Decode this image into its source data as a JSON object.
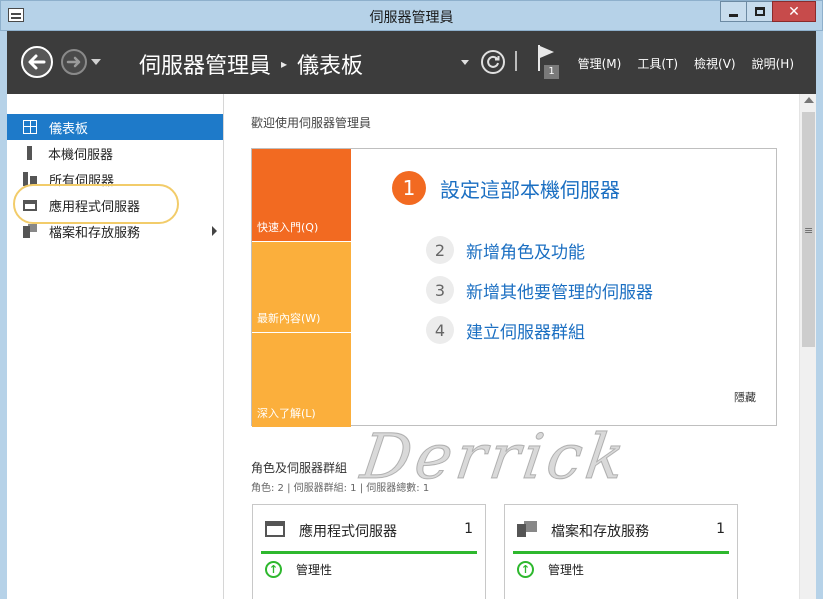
{
  "window": {
    "title": "伺服器管理員",
    "controls": {
      "minimize": "minimize",
      "maximize": "maximize",
      "close": "✕"
    }
  },
  "header": {
    "breadcrumb_root": "伺服器管理員",
    "breadcrumb_sep": "▸",
    "breadcrumb_current": "儀表板",
    "notification_count": "1",
    "menus": [
      "管理(M)",
      "工具(T)",
      "檢視(V)",
      "說明(H)"
    ]
  },
  "sidebar": {
    "items": [
      {
        "label": "儀表板",
        "icon": "dashboard-icon",
        "active": true
      },
      {
        "label": "本機伺服器",
        "icon": "server-icon"
      },
      {
        "label": "所有伺服器",
        "icon": "servers-icon"
      },
      {
        "label": "應用程式伺服器",
        "icon": "app-server-icon",
        "highlighted": true
      },
      {
        "label": "檔案和存放服務",
        "icon": "file-storage-icon",
        "has_submenu": true
      }
    ]
  },
  "main": {
    "welcome": "歡迎使用伺服器管理員",
    "tiles": [
      "快速入門(Q)",
      "最新內容(W)",
      "深入了解(L)"
    ],
    "steps": [
      {
        "num": "1",
        "label": "設定這部本機伺服器"
      },
      {
        "num": "2",
        "label": "新增角色及功能"
      },
      {
        "num": "3",
        "label": "新增其他要管理的伺服器"
      },
      {
        "num": "4",
        "label": "建立伺服器群組"
      }
    ],
    "hide": "隱藏",
    "roles_title": "角色及伺服器群組",
    "roles_sub": "角色: 2 | 伺服器群組: 1 | 伺服器總數: 1",
    "cards": [
      {
        "title": "應用程式伺服器",
        "count": "1",
        "status_icon": "↑",
        "status": "管理性"
      },
      {
        "title": "檔案和存放服務",
        "count": "1",
        "status_icon": "↑",
        "status": "管理性"
      }
    ],
    "watermark": "Derrick"
  },
  "colors": {
    "accent": "#1e7ac9",
    "tile_primary": "#f26a21",
    "tile_secondary": "#fbaf3c",
    "link": "#1b6fc2",
    "ok": "#2eb82e",
    "header_bg": "#3c3c3c"
  }
}
